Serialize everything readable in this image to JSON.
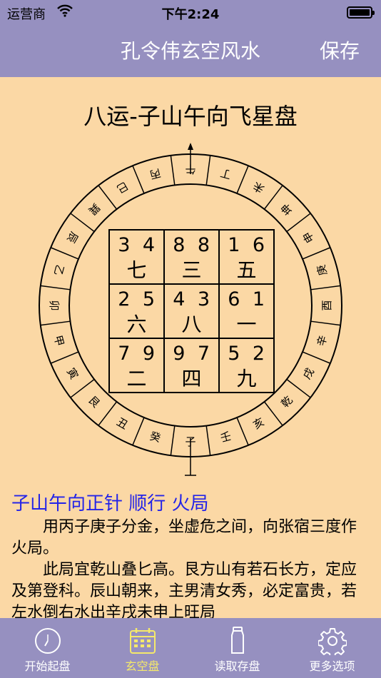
{
  "status": {
    "carrier": "运营商",
    "time": "下午2:24"
  },
  "nav": {
    "title": "孔令伟玄空风水",
    "save": "保存"
  },
  "chart_title": "八运-子山午向飞星盘",
  "compass": {
    "ring": [
      "午",
      "丁",
      "未",
      "坤",
      "申",
      "庚",
      "酉",
      "辛",
      "戌",
      "乾",
      "亥",
      "壬",
      "子",
      "癸",
      "丑",
      "艮",
      "寅",
      "甲",
      "卯",
      "乙",
      "辰",
      "巽",
      "巳",
      "丙"
    ]
  },
  "grid": [
    [
      {
        "mountain": "3",
        "facing": "4",
        "period": "七"
      },
      {
        "mountain": "8",
        "facing": "8",
        "period": "三"
      },
      {
        "mountain": "1",
        "facing": "6",
        "period": "五"
      }
    ],
    [
      {
        "mountain": "2",
        "facing": "5",
        "period": "六"
      },
      {
        "mountain": "4",
        "facing": "3",
        "period": "八"
      },
      {
        "mountain": "6",
        "facing": "1",
        "period": "一"
      }
    ],
    [
      {
        "mountain": "7",
        "facing": "9",
        "period": "二"
      },
      {
        "mountain": "9",
        "facing": "7",
        "period": "四"
      },
      {
        "mountain": "5",
        "facing": "2",
        "period": "九"
      }
    ]
  ],
  "description": {
    "headline": "子山午向正针  顺行  火局",
    "paragraphs": [
      "用丙子庚子分金，坐虚危之间，向张宿三度作火局。",
      "此局宜乾山叠匕高。艮方山有若石长方，定应及第登科。辰山朝来，主男清女秀，必定富贵，若左水倒右水出辛戌未申上旺局"
    ]
  },
  "tabs": [
    {
      "label": "开始起盘",
      "icon": "clock-icon"
    },
    {
      "label": "玄空盘",
      "icon": "calendar-icon"
    },
    {
      "label": "读取存盘",
      "icon": "bottle-icon"
    },
    {
      "label": "更多选项",
      "icon": "gear-icon"
    }
  ],
  "colors": {
    "bar": "#9690c0",
    "background": "#fbd8a5",
    "headline": "#2424e8",
    "active_tab": "#f5e96a"
  }
}
